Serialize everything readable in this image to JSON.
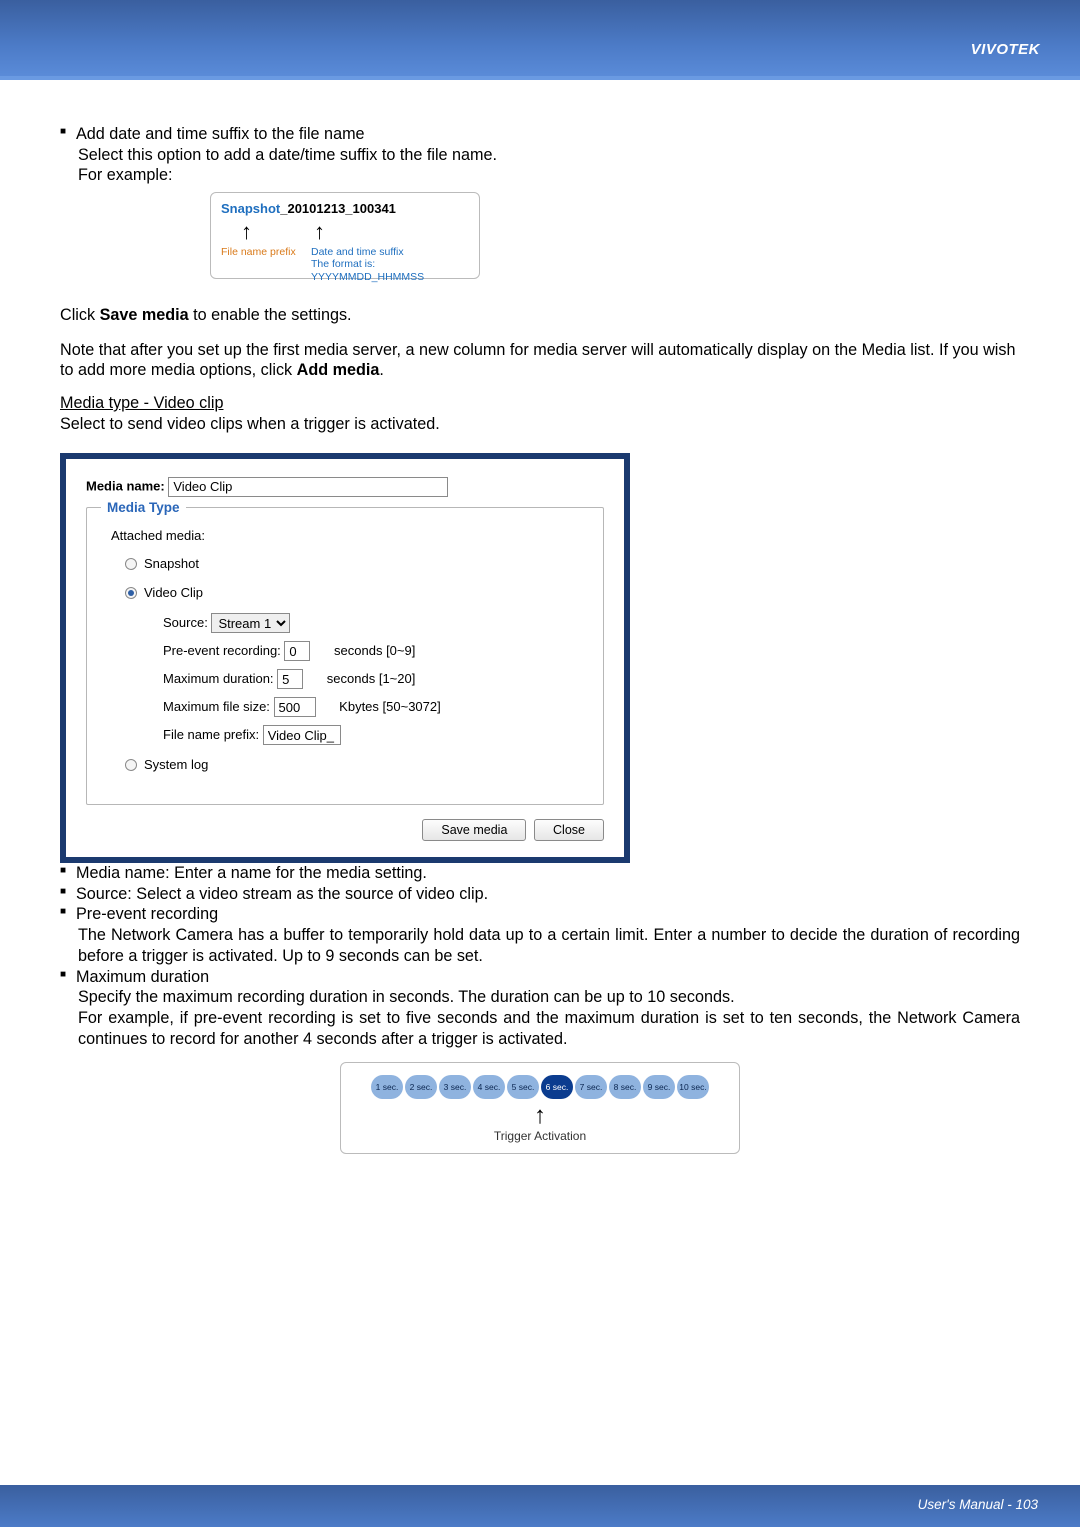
{
  "header": {
    "brand": "VIVOTEK"
  },
  "section1": {
    "bullet": "Add date and time suffix to the file name",
    "line2": "Select this option to add a date/time suffix to the file name.",
    "line3": "For example:"
  },
  "example1": {
    "prefix": "Snapshot",
    "suffix": "_20101213_100341",
    "cap_prefix": "File name prefix",
    "cap_suffix": "Date and time suffix",
    "cap_fmt": "The format is: YYYYMMDD_HHMMSS"
  },
  "save_line": {
    "pre": "Click ",
    "strong": "Save media",
    "post": " to enable the settings."
  },
  "note_line": {
    "text1": "Note that after you set up the first media server, a new column for media server will automatically display on the Media list.  If you wish to add more media options, click ",
    "strong": "Add media",
    "post": "."
  },
  "videoclip_header": "Media type - Video clip",
  "videoclip_desc": "Select to send video clips when a trigger is activated.",
  "dialog": {
    "media_name_label": "Media name:",
    "media_name_value": "Video Clip",
    "legend": "Media Type",
    "attached": "Attached media:",
    "snapshot": "Snapshot",
    "videoclip": "Video Clip",
    "source_label": "Source:",
    "source_value": "Stream 1",
    "pre_label": "Pre-event recording:",
    "pre_value": "0",
    "pre_hint": "seconds [0~9]",
    "maxdur_label": "Maximum duration:",
    "maxdur_value": "5",
    "maxdur_hint": "seconds [1~20]",
    "maxsize_label": "Maximum file size:",
    "maxsize_value": "500",
    "maxsize_hint": "Kbytes [50~3072]",
    "prefix_label": "File name prefix:",
    "prefix_value": "Video Clip_",
    "syslog": "System log",
    "save_btn": "Save media",
    "close_btn": "Close"
  },
  "desc": {
    "b1": "Media name: Enter a name for the media setting.",
    "b2": "Source: Select a video stream as the source of video clip.",
    "b3_title": "Pre-event recording",
    "b3_body": "The Network Camera has a buffer to temporarily hold data up to a certain limit. Enter a number to decide the duration of recording before a trigger is activated. Up to 9 seconds can be set.",
    "b4_title": "Maximum duration",
    "b4_l1": "Specify the maximum recording duration in seconds. The duration can be up to 10 seconds.",
    "b4_l2": "For example, if pre-event recording is set to five seconds and the maximum duration is set to ten seconds, the Network Camera continues to record for another 4 seconds after a trigger is activated."
  },
  "timeline": {
    "chips": [
      "1 sec.",
      "2 sec.",
      "3 sec.",
      "4 sec.",
      "5 sec.",
      "6 sec.",
      "7 sec.",
      "8 sec.",
      "9 sec.",
      "10 sec."
    ],
    "highlight_index": 5,
    "label": "Trigger Activation"
  },
  "footer": {
    "text": "User's Manual - 103"
  }
}
